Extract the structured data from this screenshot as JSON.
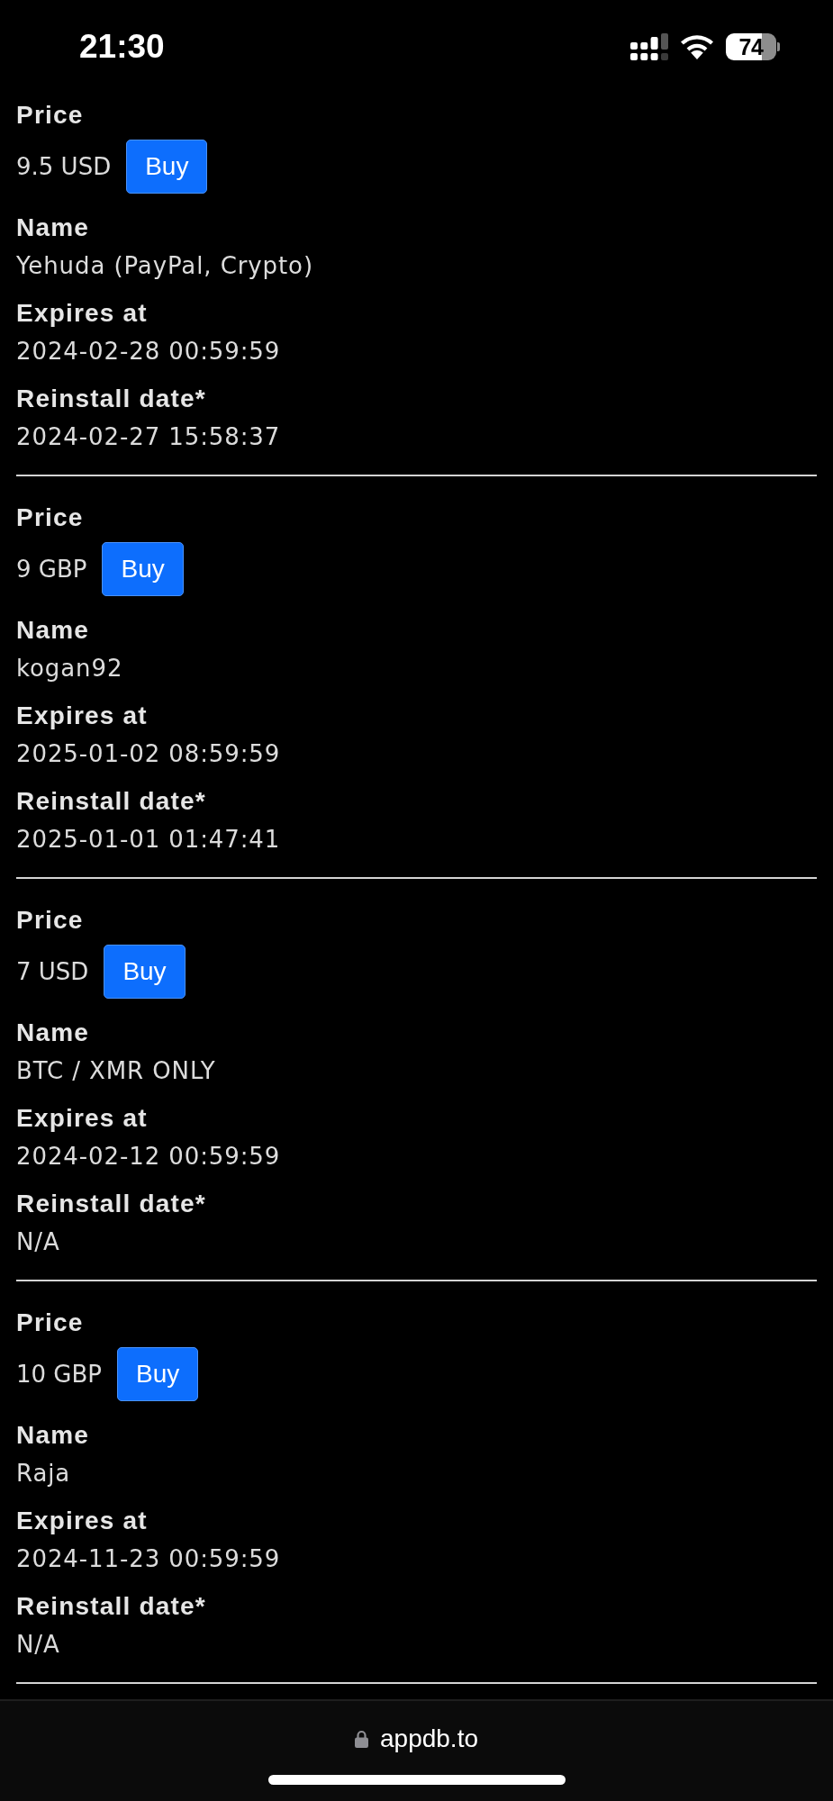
{
  "status_bar": {
    "time": "21:30",
    "battery": "74"
  },
  "listings": [
    {
      "price_label": "Price",
      "price": "9.5 USD",
      "buy_button": "Buy",
      "fields": [
        {
          "label": "Name",
          "value": "Yehuda (PayPal, Crypto)"
        },
        {
          "label": "Expires at",
          "value": "2024-02-28 00:59:59"
        },
        {
          "label": "Reinstall date*",
          "value": "2024-02-27 15:58:37"
        }
      ]
    },
    {
      "price_label": "Price",
      "price": "9 GBP",
      "buy_button": "Buy",
      "fields": [
        {
          "label": "Name",
          "value": "kogan92"
        },
        {
          "label": "Expires at",
          "value": "2025-01-02 08:59:59"
        },
        {
          "label": "Reinstall date*",
          "value": "2025-01-01 01:47:41"
        }
      ]
    },
    {
      "price_label": "Price",
      "price": "7 USD",
      "buy_button": "Buy",
      "fields": [
        {
          "label": "Name",
          "value": "BTC / XMR ONLY"
        },
        {
          "label": "Expires at",
          "value": "2024-02-12 00:59:59"
        },
        {
          "label": "Reinstall date*",
          "value": "N/A"
        }
      ]
    },
    {
      "price_label": "Price",
      "price": "10 GBP",
      "buy_button": "Buy",
      "fields": [
        {
          "label": "Name",
          "value": "Raja"
        },
        {
          "label": "Expires at",
          "value": "2024-11-23 00:59:59"
        },
        {
          "label": "Reinstall date*",
          "value": "N/A"
        }
      ]
    }
  ],
  "address_bar": {
    "url": "appdb.to"
  }
}
